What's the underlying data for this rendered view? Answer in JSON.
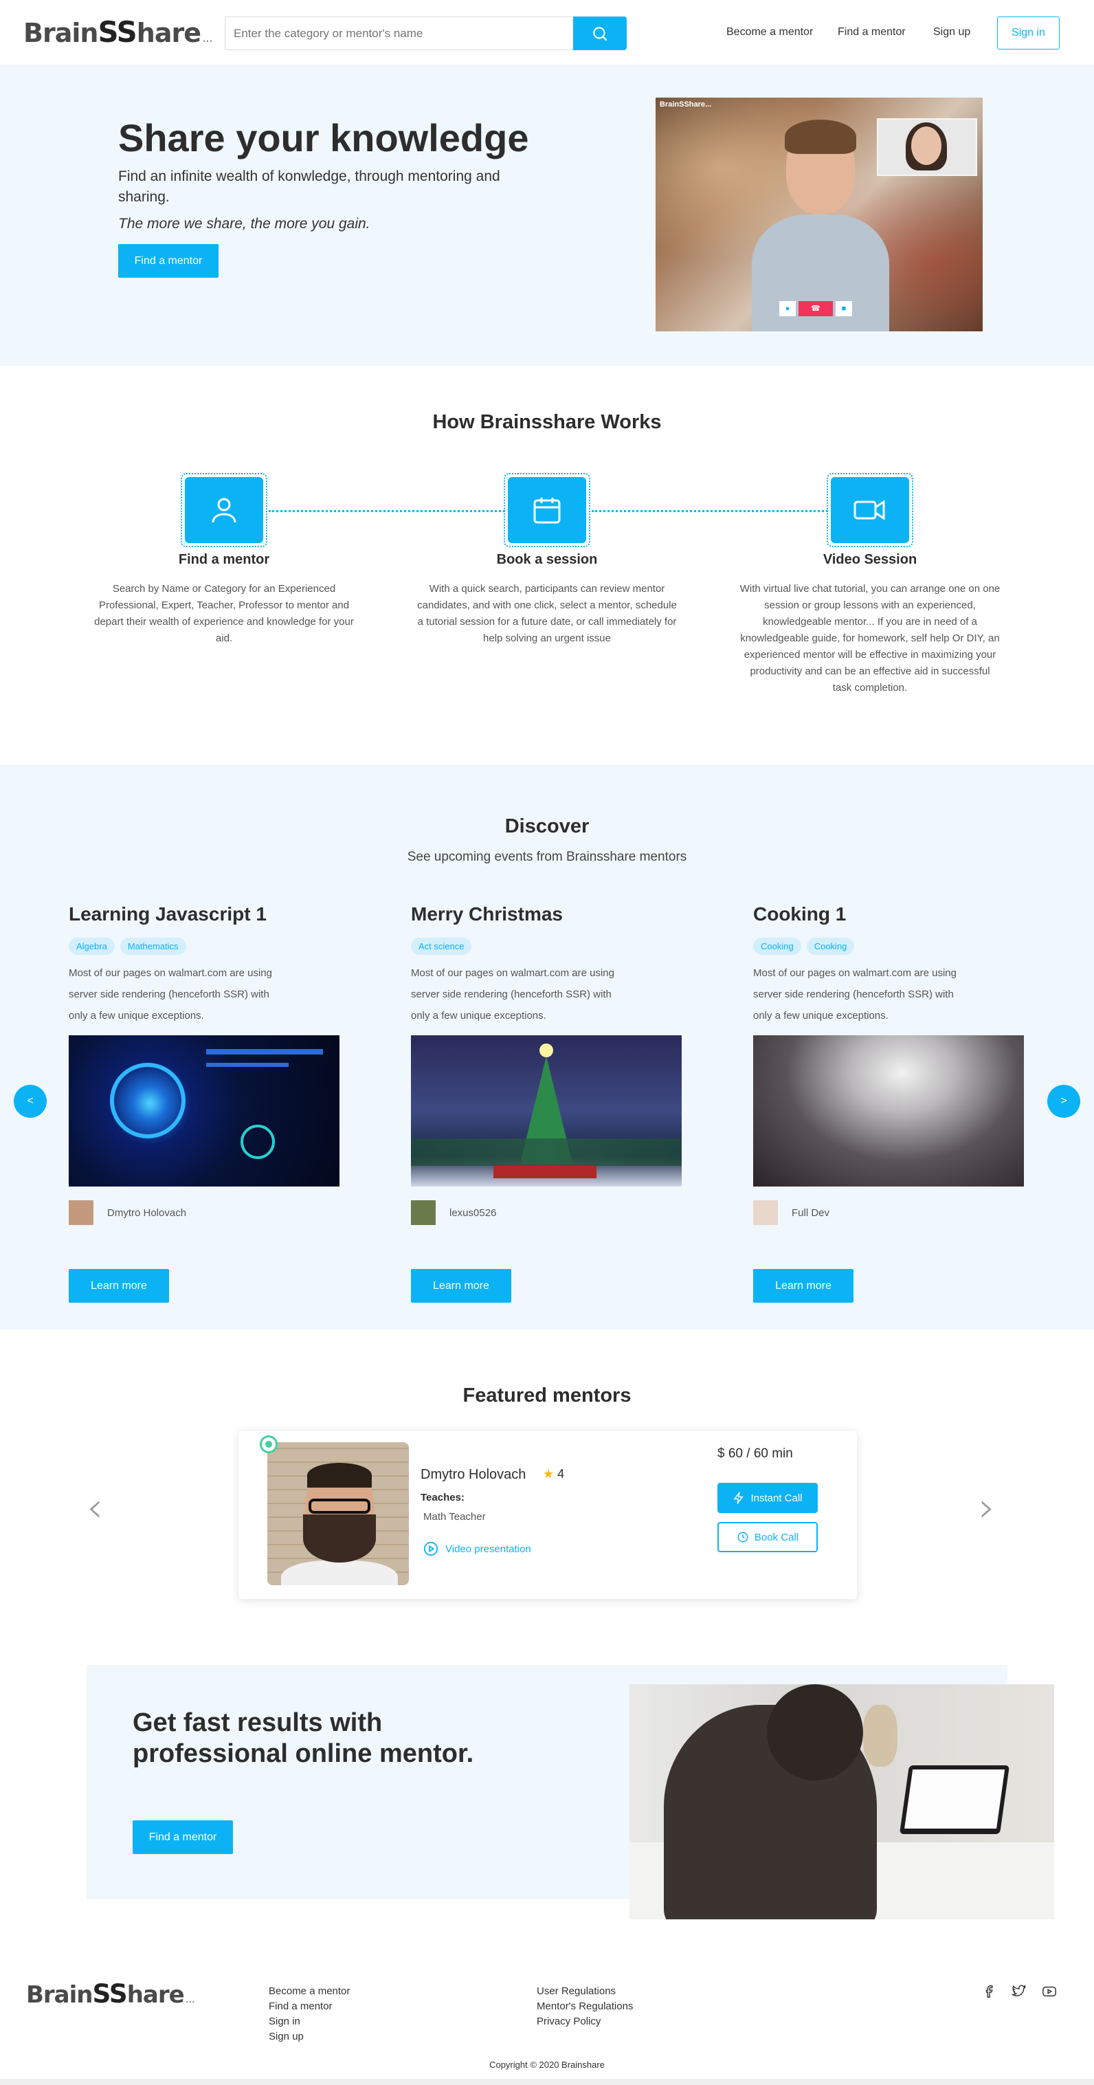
{
  "header": {
    "logo_main": "Brain",
    "logo_ss": "SS",
    "logo_rest": "hare",
    "logo_dots": "...",
    "search_placeholder": "Enter the category or mentor's name",
    "nav": [
      "Become a mentor",
      "Find a mentor",
      "Sign up"
    ],
    "signin_label": "Sign in"
  },
  "hero": {
    "title": "Share your knowledge",
    "description": "Find an infinite wealth of konwledge, through mentoring and sharing.",
    "quote": "The more we share, the more you gain.",
    "button_label": "Find a mentor",
    "image_logo": "BrainSShare..."
  },
  "how": {
    "title": "How Brainsshare Works",
    "steps": [
      {
        "title": "Find a mentor",
        "icon": "user-icon",
        "text": "Search by Name or Category for an Experienced Professional, Expert, Teacher, Professor to mentor and depart their wealth of experience and knowledge for your aid."
      },
      {
        "title": "Book a session",
        "icon": "calendar-icon",
        "text": "With a quick search, participants can review mentor candidates, and with one click, select a mentor, schedule a tutorial session for a future date, or call immediately for help solving an urgent issue"
      },
      {
        "title": "Video Session",
        "icon": "video-camera-icon",
        "text": "With virtual live chat tutorial, you can arrange one on one session or group lessons with an experienced, knowledgeable mentor... If you are in need of a knowledgeable guide, for homework, self help Or DIY, an experienced mentor will be effective in maximizing your productivity and can be an effective aid in successful task completion."
      }
    ]
  },
  "discover": {
    "title": "Discover",
    "subtitle": "See upcoming events from Brainsshare mentors",
    "prev_label": "<",
    "next_label": ">",
    "events": [
      {
        "title": "Learning Javascript 1",
        "tags": [
          "Algebra",
          "Mathematics"
        ],
        "description": "Most of our pages on walmart.com are using server side rendering (henceforth SSR) with only a few unique exceptions.",
        "author": "Dmytro Holovach",
        "button_label": "Learn more"
      },
      {
        "title": "Merry Christmas",
        "tags": [
          "Act science"
        ],
        "description": "Most of our pages on walmart.com are using server side rendering (henceforth SSR) with only a few unique exceptions.",
        "author": "lexus0526",
        "button_label": "Learn more"
      },
      {
        "title": "Cooking 1",
        "tags": [
          "Cooking",
          "Cooking"
        ],
        "description": "Most of our pages on walmart.com are using server side rendering (henceforth SSR) with only a few unique exceptions.",
        "author": "Full Dev",
        "button_label": "Learn more"
      }
    ]
  },
  "featured": {
    "title": "Featured mentors",
    "mentor": {
      "name": "Dmytro Holovach",
      "rating": "4",
      "teaches_label": "Teaches:",
      "subject": "Math Teacher",
      "video_label": "Video presentation",
      "price": "$ 60 / 60 min",
      "instant_label": "Instant Call",
      "book_label": "Book Call"
    }
  },
  "cta": {
    "title": "Get fast results with professional online mentor.",
    "button_label": "Find a mentor"
  },
  "footer": {
    "col1": [
      "Become a mentor",
      "Find a mentor",
      "Sign in",
      "Sign up"
    ],
    "col2": [
      "User Regulations",
      "Mentor's Regulations",
      "Privacy Policy"
    ],
    "copyright": "Copyright © 2020 Brainshare"
  },
  "colors": {
    "accent": "#0bb3f5",
    "light_bg": "#f0f7fd",
    "online": "#43d19e",
    "star": "#f5b800"
  }
}
